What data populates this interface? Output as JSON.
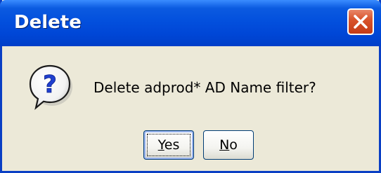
{
  "dialog": {
    "title": "Delete",
    "close_icon": "close-x-icon",
    "message": "Delete adprod* AD Name filter?",
    "icon": "question-icon",
    "buttons": {
      "yes": {
        "mnemonic": "Y",
        "rest": "es"
      },
      "no": {
        "mnemonic": "N",
        "rest": "o"
      }
    }
  },
  "colors": {
    "titlebar": "#0350dd",
    "frame": "#0a3fc4",
    "body": "#ece9d8",
    "close": "#d9542c"
  }
}
